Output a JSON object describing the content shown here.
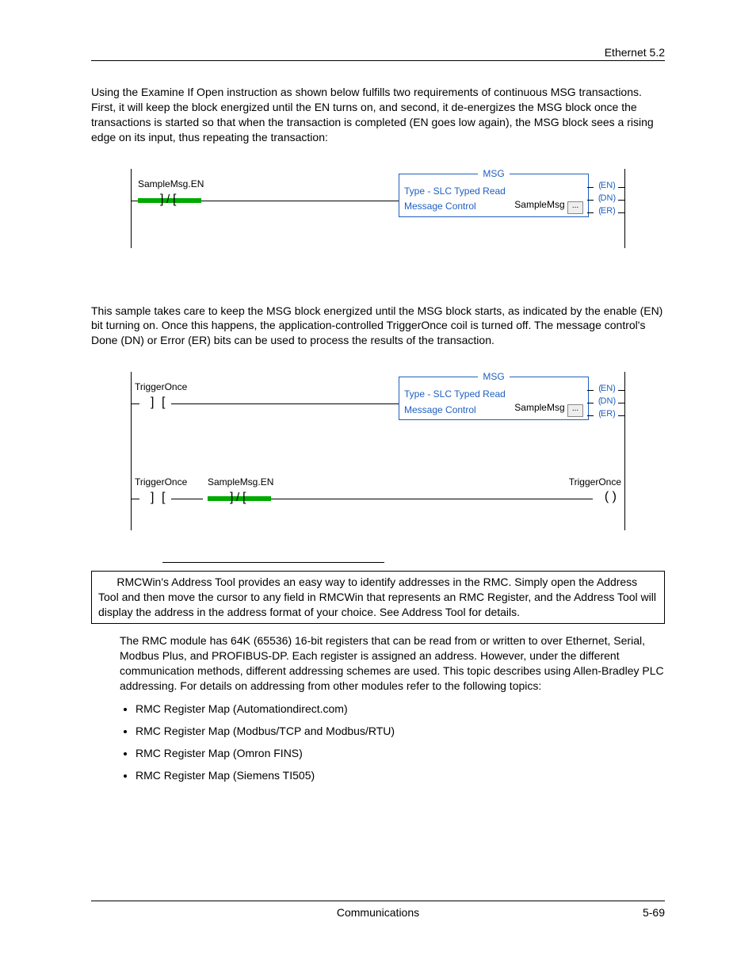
{
  "header": {
    "section": "Ethernet  5.2"
  },
  "para1": "Using the Examine If Open instruction as shown below fulfills two requirements of continuous MSG transactions. First, it will keep the block energized until the EN turns on, and second, it de-energizes the MSG block once the transactions is started so that when the transaction is completed (EN goes low again), the MSG block sees a rising edge on its input, thus repeating the transaction:",
  "ladder1": {
    "tag": "SampleMsg.EN",
    "msg": {
      "title": "MSG",
      "type_label": "Type - SLC Typed Read",
      "ctrl_label": "Message Control",
      "ctrl_value": "SampleMsg",
      "dots": "...",
      "outputs": [
        "EN",
        "DN",
        "ER"
      ]
    }
  },
  "para2": "This sample takes care to keep the MSG block energized until the MSG block starts, as indicated by the enable (EN) bit turning on. Once this happens, the application-controlled TriggerOnce coil is turned off. The message control's Done (DN) or Error (ER) bits can be used to process the results of the transaction.",
  "ladder2": {
    "rung1": {
      "tag": "TriggerOnce",
      "msg": {
        "title": "MSG",
        "type_label": "Type - SLC Typed Read",
        "ctrl_label": "Message Control",
        "ctrl_value": "SampleMsg",
        "dots": "...",
        "outputs": [
          "EN",
          "DN",
          "ER"
        ]
      }
    },
    "rung2": {
      "tag1": "TriggerOnce",
      "tag2": "SampleMsg.EN",
      "coil_tag": "TriggerOnce"
    }
  },
  "tip": "RMCWin's Address Tool provides an easy way to identify addresses in the RMC. Simply open the Address Tool and then move the cursor to any field in RMCWin that represents an RMC Register, and the Address Tool will display the address in the address format of your choice. See Address Tool for details.",
  "para3": "The RMC module has 64K (65536) 16-bit registers that can be read from or written to over Ethernet, Serial, Modbus Plus, and PROFIBUS-DP. Each register is assigned an address. However, under the different communication methods, different addressing schemes are used. This topic describes using Allen-Bradley PLC addressing. For details on addressing from other modules refer to the following topics:",
  "bullets": [
    "RMC Register Map (Automationdirect.com)",
    "RMC Register Map (Modbus/TCP and Modbus/RTU)",
    "RMC Register Map (Omron FINS)",
    "RMC Register Map (Siemens TI505)"
  ],
  "footer": {
    "center": "Communications",
    "right": "5-69"
  }
}
